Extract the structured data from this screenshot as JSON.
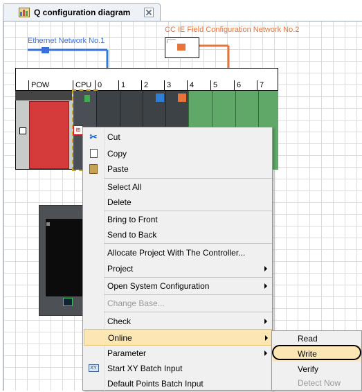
{
  "tab": {
    "title": "Q configuration diagram",
    "icon": "configuration-diagram-icon"
  },
  "networks": {
    "ethernet_label": "Ethernet Network No.1",
    "ccie_label": "CC IE Field Configuration Network No.2",
    "ethernet_color": "#3a6fd8",
    "ccie_color": "#e8743b"
  },
  "base": {
    "slots": [
      "POW",
      "CPU",
      "0",
      "1",
      "2",
      "3",
      "4",
      "5",
      "6",
      "7"
    ]
  },
  "context_menu": {
    "items": [
      {
        "label": "Cut",
        "icon": "scissors-icon"
      },
      {
        "label": "Copy",
        "icon": "copy-icon"
      },
      {
        "label": "Paste",
        "icon": "paste-icon"
      },
      {
        "label": "Select All"
      },
      {
        "label": "Delete"
      },
      {
        "label": "Bring to Front"
      },
      {
        "label": "Send to Back"
      },
      {
        "label": "Allocate Project With The Controller..."
      },
      {
        "label": "Project",
        "submenu": true
      },
      {
        "label": "Open System Configuration",
        "submenu": true
      },
      {
        "label": "Change Base...",
        "disabled": true
      },
      {
        "label": "Check",
        "submenu": true
      },
      {
        "label": "Online",
        "submenu": true,
        "highlighted": true
      },
      {
        "label": "Parameter",
        "submenu": true
      },
      {
        "label": "Start XY Batch Input",
        "icon": "xy-batch-input-icon"
      },
      {
        "label": "Default Points Batch Input"
      }
    ]
  },
  "online_submenu": {
    "items": [
      {
        "label": "Read"
      },
      {
        "label": "Write",
        "highlighted": true
      },
      {
        "label": "Verify"
      },
      {
        "label": "Detect Now",
        "disabled": true
      }
    ]
  }
}
